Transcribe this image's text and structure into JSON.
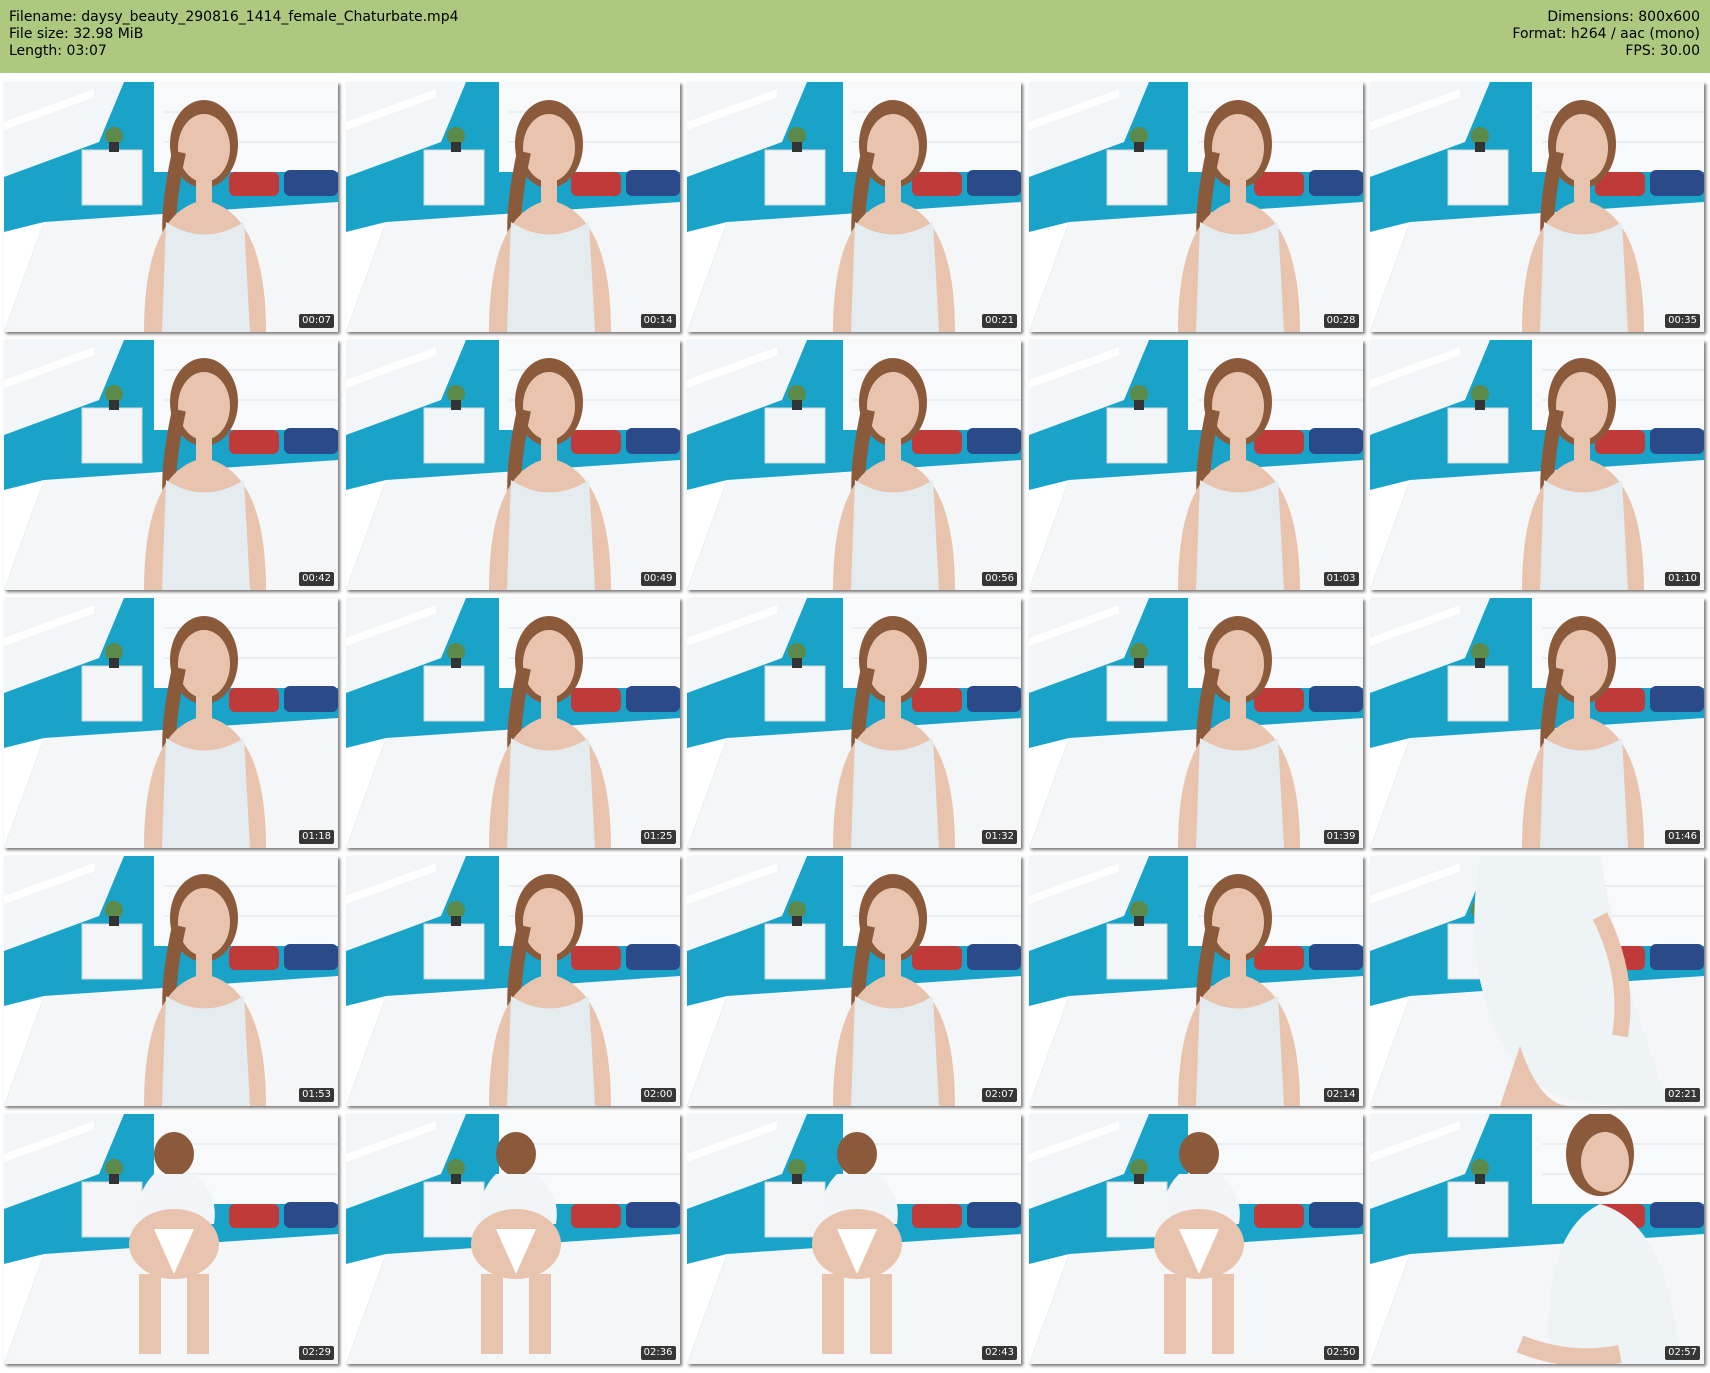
{
  "header": {
    "filename": "Filename: daysy_beauty_290816_1414_female_Chaturbate.mp4",
    "filesize": "File size: 32.98 MiB",
    "length": "Length: 03:07",
    "dimensions": "Dimensions: 800x600",
    "format": "Format: h264 / aac (mono)",
    "fps": "FPS: 30.00"
  },
  "colors": {
    "header_bg": "#adc980",
    "wall_blue": "#1aa3c9",
    "bed_white": "#f4f6f8",
    "skin": "#e8c4ae",
    "hair": "#8a5a3a"
  },
  "thumbnails": [
    {
      "time": "00:07",
      "pose": "front"
    },
    {
      "time": "00:14",
      "pose": "front"
    },
    {
      "time": "00:21",
      "pose": "front"
    },
    {
      "time": "00:28",
      "pose": "front"
    },
    {
      "time": "00:35",
      "pose": "front"
    },
    {
      "time": "00:42",
      "pose": "front"
    },
    {
      "time": "00:49",
      "pose": "front"
    },
    {
      "time": "00:56",
      "pose": "front"
    },
    {
      "time": "01:03",
      "pose": "front"
    },
    {
      "time": "01:10",
      "pose": "front"
    },
    {
      "time": "01:18",
      "pose": "front"
    },
    {
      "time": "01:25",
      "pose": "front"
    },
    {
      "time": "01:32",
      "pose": "front"
    },
    {
      "time": "01:39",
      "pose": "front"
    },
    {
      "time": "01:46",
      "pose": "front"
    },
    {
      "time": "01:53",
      "pose": "front"
    },
    {
      "time": "02:00",
      "pose": "front"
    },
    {
      "time": "02:07",
      "pose": "front"
    },
    {
      "time": "02:14",
      "pose": "front"
    },
    {
      "time": "02:21",
      "pose": "closeup"
    },
    {
      "time": "02:29",
      "pose": "back"
    },
    {
      "time": "02:36",
      "pose": "back"
    },
    {
      "time": "02:43",
      "pose": "back"
    },
    {
      "time": "02:50",
      "pose": "back"
    },
    {
      "time": "02:57",
      "pose": "side"
    }
  ]
}
